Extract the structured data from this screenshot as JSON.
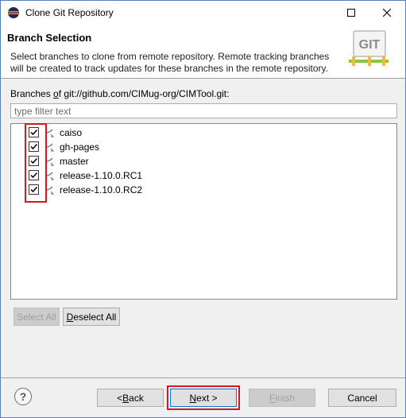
{
  "window": {
    "title": "Clone Git Repository"
  },
  "banner": {
    "title": "Branch Selection",
    "description": "Select branches to clone from remote repository. Remote tracking branches will be created to track updates for these branches in the remote repository.",
    "logo_text": "GIT"
  },
  "branches": {
    "label_prefix": "Branches ",
    "label_mnemonic": "o",
    "label_rest_pre": "f",
    "label_rest": " git://github.com/CIMug-org/CIMTool.git:",
    "filter_placeholder": "type filter text",
    "items": [
      {
        "label": "caiso",
        "checked": true
      },
      {
        "label": "gh-pages",
        "checked": true
      },
      {
        "label": "master",
        "checked": true
      },
      {
        "label": "release-1.10.0.RC1",
        "checked": true
      },
      {
        "label": "release-1.10.0.RC2",
        "checked": true
      }
    ]
  },
  "buttons": {
    "select_all": "Select All",
    "deselect_all_mnemonic": "D",
    "deselect_all_rest": "eselect All",
    "back_prefix": "< ",
    "back_mnemonic": "B",
    "back_rest": "ack",
    "next_mnemonic": "N",
    "next_rest": "ext >",
    "finish_mnemonic": "F",
    "finish_rest": "inish",
    "cancel": "Cancel",
    "help": "?"
  }
}
